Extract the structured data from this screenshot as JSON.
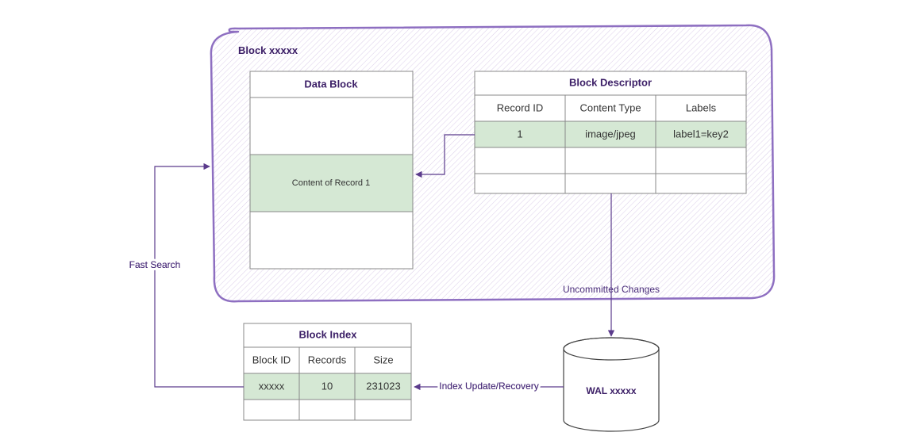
{
  "colors": {
    "purple": "#8e6fc1",
    "dark_purple": "#3b1e66",
    "green": "#d5e8d4",
    "grey": "#888888"
  },
  "block_container": {
    "title": "Block xxxxx"
  },
  "data_block": {
    "title": "Data Block",
    "record_label": "Content of Record 1"
  },
  "block_descriptor": {
    "title": "Block Descriptor",
    "headers": [
      "Record ID",
      "Content Type",
      "Labels"
    ],
    "row": [
      "1",
      "image/jpeg",
      "label1=key2"
    ]
  },
  "block_index": {
    "title": "Block Index",
    "headers": [
      "Block ID",
      "Records",
      "Size"
    ],
    "row": [
      "xxxxx",
      "10",
      "231023"
    ]
  },
  "wal": {
    "title": "WAL xxxxx"
  },
  "labels": {
    "fast_search": "Fast Search",
    "uncommitted": "Uncommitted Changes",
    "index_update": "Index Update/Recovery"
  }
}
